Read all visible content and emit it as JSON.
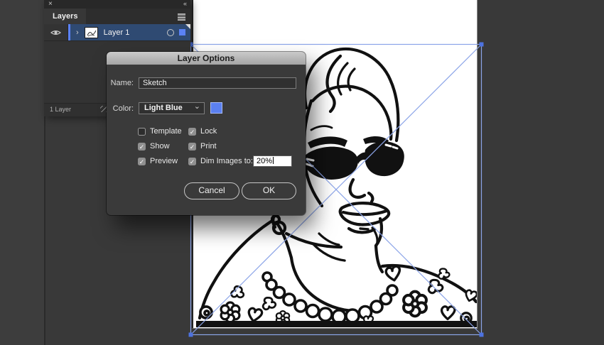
{
  "app": {
    "background": "#393939"
  },
  "layers_panel": {
    "close_glyph": "×",
    "collapse_glyph": "«",
    "panel_tab": "Layers",
    "layer_row": {
      "expand_glyph": "›",
      "name": "Layer 1"
    },
    "status_text": "1 Layer",
    "selection_row_color": "#2f4a72",
    "accent_color": "#5b82f5"
  },
  "dialog": {
    "title": "Layer Options",
    "name_label": "Name:",
    "name_value": "Sketch",
    "color_label": "Color:",
    "color_value": "Light Blue",
    "dropdown_glyph": "⌄",
    "swatch_color": "#5b80f0",
    "check_glyph": "✓",
    "checkboxes": [
      {
        "label": "Template",
        "checked": false
      },
      {
        "label": "Lock",
        "checked": true
      },
      {
        "label": "Show",
        "checked": true
      },
      {
        "label": "Print",
        "checked": true
      },
      {
        "label": "Preview",
        "checked": true
      },
      {
        "label": "Dim Images to:",
        "checked": true
      }
    ],
    "dim_images_value": "20%",
    "cancel_label": "Cancel",
    "ok_label": "OK"
  },
  "canvas": {
    "selection_stroke": "#8ba4e8",
    "handle_fill": "#4d72e0",
    "artwork_description": "Black line-art portrait of a woman with sunglasses, pearl necklace and floral top"
  }
}
